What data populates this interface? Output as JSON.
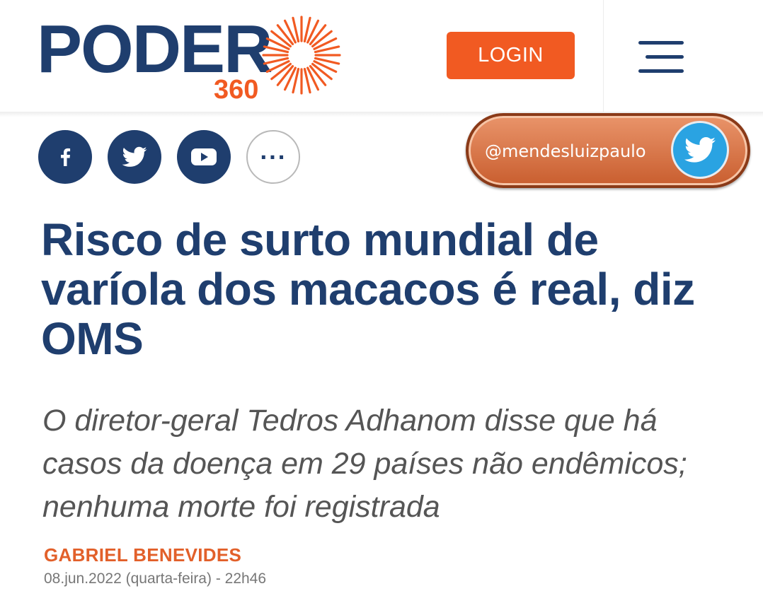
{
  "header": {
    "logo_word": "PODER",
    "logo_number": "360",
    "login_label": "LOGIN"
  },
  "social": {
    "icons": [
      "facebook-icon",
      "twitter-icon",
      "youtube-icon",
      "more-icon"
    ],
    "more_label": "···"
  },
  "overlay": {
    "handle": "@mendesluizpaulo",
    "icon": "twitter-icon"
  },
  "article": {
    "title": "Risco de surto mundial de varíola dos macacos é real, diz OMS",
    "subtitle": "O diretor-geral Tedros Adhanom disse que há casos da doença em 29 países não endêmicos; nenhuma morte foi registrada",
    "author": "GABRIEL BENEVIDES",
    "date": "08.jun.2022 (quarta-feira) - 22h46"
  },
  "colors": {
    "brand_navy": "#1f3e6e",
    "brand_orange": "#f15a22",
    "author_orange": "#e2602a",
    "twitter_blue": "#2aa3e2"
  }
}
